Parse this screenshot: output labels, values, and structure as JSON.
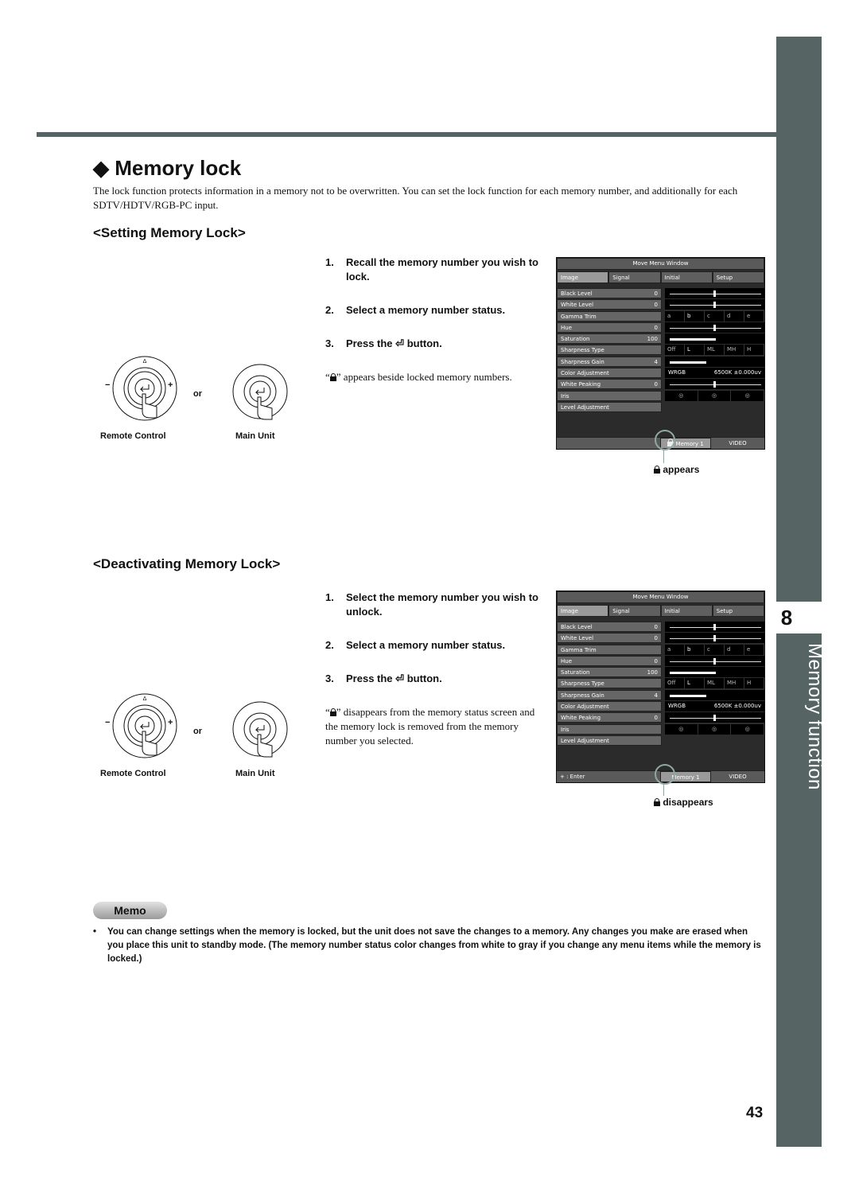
{
  "page": {
    "section_title": "Memory lock",
    "intro": "The lock function protects information in a memory not to be overwritten. You can set the lock function for each memory number, and additionally for each SDTV/HDTV/RGB-PC input.",
    "chapter_number": "8",
    "chapter_title": "Memory function",
    "page_number": "43"
  },
  "setting": {
    "heading": "<Setting Memory Lock>",
    "steps": [
      {
        "num": "1.",
        "text": "Recall the memory number you wish to lock."
      },
      {
        "num": "2.",
        "text": "Select a memory number status."
      },
      {
        "num": "3.",
        "pre": "Press the",
        "post": "button."
      }
    ],
    "note_pre": "“",
    "note_post": "” appears beside locked memory numbers.",
    "callout": "appears"
  },
  "deactivating": {
    "heading": "<Deactivating Memory Lock>",
    "steps": [
      {
        "num": "1.",
        "text": "Select the memory number you wish to unlock."
      },
      {
        "num": "2.",
        "text": "Select a memory number status."
      },
      {
        "num": "3.",
        "pre": "Press the",
        "post": "button."
      }
    ],
    "note_pre": "“",
    "note_post": "” disappears from the memory status screen and the memory lock is removed from the memory number you selected.",
    "callout": "disappears"
  },
  "controls": {
    "remote_label": "Remote Control",
    "main_label": "Main Unit",
    "or": "or",
    "minus": "−",
    "plus": "+"
  },
  "osd": {
    "title": "Move Menu Window",
    "tabs": [
      "Image",
      "Signal",
      "Initial",
      "Setup"
    ],
    "rows": [
      {
        "label": "Black Level",
        "value": "0",
        "type": "slider",
        "position": 0.5
      },
      {
        "label": "White Level",
        "value": "0",
        "type": "slider",
        "position": 0.5
      },
      {
        "label": "Gamma Trim",
        "value": "",
        "type": "options",
        "options": [
          "a",
          "b",
          "c",
          "d",
          "e"
        ],
        "selected": 1
      },
      {
        "label": "Hue",
        "value": "0",
        "type": "slider",
        "position": 0.5
      },
      {
        "label": "Saturation",
        "value": "100",
        "type": "fill",
        "position": 0.5
      },
      {
        "label": "Sharpness Type",
        "value": "",
        "type": "options",
        "options": [
          "Off",
          "L",
          "ML",
          "MH",
          "H"
        ],
        "selected": 1
      },
      {
        "label": "Sharpness Gain",
        "value": "4",
        "type": "fill",
        "position": 0.4
      },
      {
        "label": "Color Adjustment",
        "value": "",
        "type": "text",
        "left": "WRGB",
        "right": "6500K ±0.000uv"
      },
      {
        "label": "White Peaking",
        "value": "0",
        "type": "slider",
        "position": 0.5
      },
      {
        "label": "Iris",
        "value": "",
        "type": "iris"
      },
      {
        "label": "Level Adjustment",
        "value": "",
        "type": "none"
      }
    ],
    "status_locked": {
      "left": "",
      "memory": "Memory 1",
      "source": "VIDEO"
    },
    "status_unlocked": {
      "left": "+ : Enter",
      "memory": "Memory 1",
      "source": "VIDEO"
    }
  },
  "memo": {
    "badge": "Memo",
    "bullet": "•",
    "text": "You can change settings when the memory is locked, but the unit does not save the changes to a memory. Any changes you make are erased when you place this unit to standby mode. (The memory number status color changes from white to gray if you change any menu items while the memory is locked.)"
  }
}
